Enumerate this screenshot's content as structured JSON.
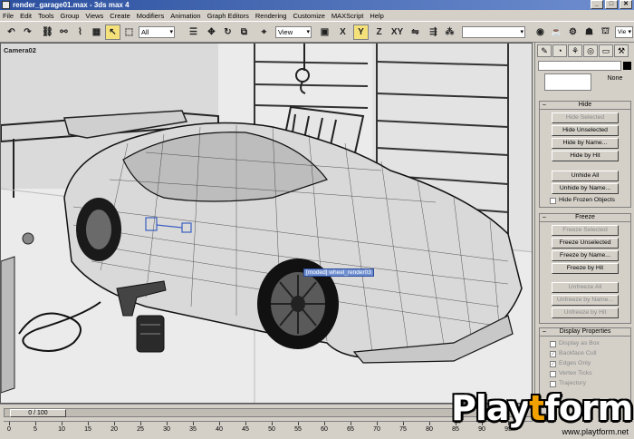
{
  "window": {
    "title": "render_garage01.max - 3ds max 4",
    "min": "_",
    "max": "□",
    "close": "✕"
  },
  "menu": [
    "File",
    "Edit",
    "Tools",
    "Group",
    "Views",
    "Create",
    "Modifiers",
    "Animation",
    "Graph Editors",
    "Rendering",
    "Customize",
    "MAXScript",
    "Help"
  ],
  "toolbar": {
    "selection_filter": "All",
    "ref_coord": "View",
    "axis_x": "X",
    "axis_y": "Y",
    "axis_z": "Z",
    "axis_xy": "XY",
    "viewport_preset": "Vie"
  },
  "viewport": {
    "label": "Camera02",
    "selection_label": "[moded] wheel_render03"
  },
  "command_panel": {
    "none_label": "None",
    "hide": {
      "title": "Hide",
      "buttons": [
        {
          "label": "Hide Selected",
          "enabled": false
        },
        {
          "label": "Hide Unselected",
          "enabled": true
        },
        {
          "label": "Hide by Name...",
          "enabled": true
        },
        {
          "label": "Hide by Hit",
          "enabled": true
        },
        {
          "label": "Unhide All",
          "enabled": true
        },
        {
          "label": "Unhide by Name...",
          "enabled": true
        }
      ],
      "checkbox": "Hide Frozen Objects"
    },
    "freeze": {
      "title": "Freeze",
      "buttons": [
        {
          "label": "Freeze Selected",
          "enabled": false
        },
        {
          "label": "Freeze Unselected",
          "enabled": true
        },
        {
          "label": "Freeze by Name...",
          "enabled": true
        },
        {
          "label": "Freeze by Hit",
          "enabled": true
        },
        {
          "label": "Unfreeze All",
          "enabled": false
        },
        {
          "label": "Unfreeze by Name...",
          "enabled": false
        },
        {
          "label": "Unfreeze by Hit",
          "enabled": false
        }
      ]
    },
    "display_properties": {
      "title": "Display Properties",
      "items": [
        {
          "label": "Display as Box",
          "checked": false
        },
        {
          "label": "Backface Cull",
          "checked": true
        },
        {
          "label": "Edges Only",
          "checked": true
        },
        {
          "label": "Vertex Ticks",
          "checked": false
        },
        {
          "label": "Trajectory",
          "checked": false
        }
      ]
    }
  },
  "timeline": {
    "frame_counter": "0 / 100",
    "ticks": [
      "0",
      "5",
      "10",
      "15",
      "20",
      "25",
      "30",
      "35",
      "40",
      "45",
      "50",
      "55",
      "60",
      "65",
      "70",
      "75",
      "80",
      "85",
      "90",
      "95"
    ]
  },
  "watermark": {
    "brand_part1": "Play",
    "brand_part2": "t",
    "brand_part3": "form",
    "url": "www.playtform.net"
  }
}
